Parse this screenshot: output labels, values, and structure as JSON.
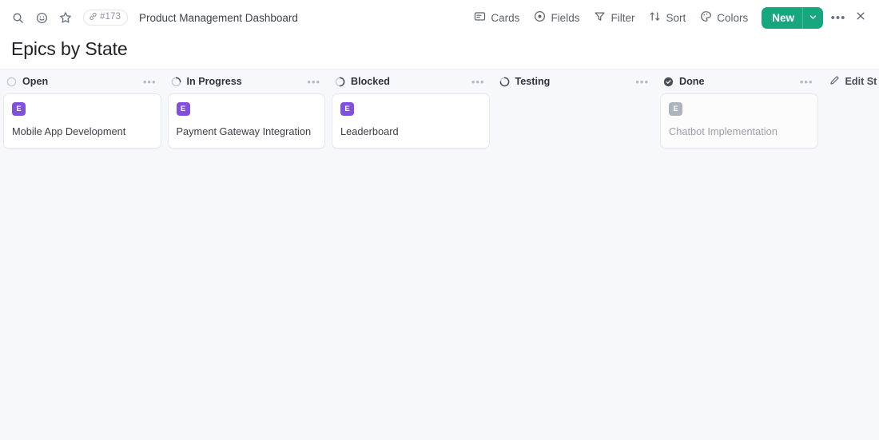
{
  "toolbar": {
    "search_icon": "search-icon",
    "reaction_icon": "emoji-smiley-icon",
    "star_icon": "star-icon",
    "issue_ref": "#173",
    "link_icon": "link-icon",
    "document_title": "Product Management Dashboard",
    "actions": [
      {
        "label": "Cards",
        "icon": "cards-icon"
      },
      {
        "label": "Fields",
        "icon": "fields-eye-icon"
      },
      {
        "label": "Filter",
        "icon": "filter-funnel-icon"
      },
      {
        "label": "Sort",
        "icon": "sort-arrows-icon"
      },
      {
        "label": "Colors",
        "icon": "colors-palette-icon"
      }
    ],
    "new_button": "New",
    "new_caret_icon": "chevron-down-icon",
    "overflow_icon": "ellipsis-icon",
    "close_icon": "close-icon"
  },
  "page": {
    "title": "Epics by State"
  },
  "board": {
    "edit_statuses_label": "Edit St",
    "edit_statuses_icon": "pencil-icon",
    "column_menu_icon": "ellipsis-icon",
    "columns": [
      {
        "name": "Open",
        "status_icon": "circle-open-icon",
        "cards": [
          {
            "badge": "E",
            "title": "Mobile App Development",
            "muted": false
          }
        ]
      },
      {
        "name": "In Progress",
        "status_icon": "circle-quarter-progress-icon",
        "cards": [
          {
            "badge": "E",
            "title": "Payment Gateway Integration",
            "muted": false
          }
        ]
      },
      {
        "name": "Blocked",
        "status_icon": "circle-half-progress-icon",
        "cards": [
          {
            "badge": "E",
            "title": "Leaderboard",
            "muted": false
          }
        ]
      },
      {
        "name": "Testing",
        "status_icon": "circle-three-quarter-progress-icon",
        "cards": []
      },
      {
        "name": "Done",
        "status_icon": "check-circle-filled-icon",
        "cards": [
          {
            "badge": "E",
            "title": "Chatbot Implementation",
            "muted": true
          }
        ]
      }
    ]
  },
  "colors": {
    "accent_teal": "#17a67e",
    "epic_purple": "#8250df",
    "board_background": "#f7f8fb",
    "done_grey": "#aeb4bd"
  }
}
